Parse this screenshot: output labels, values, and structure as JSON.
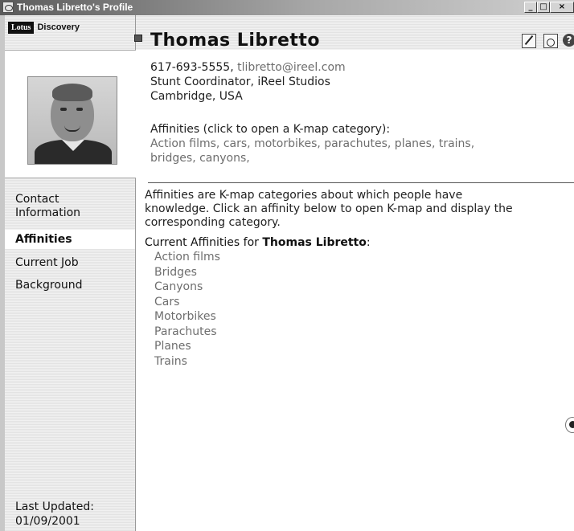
{
  "window": {
    "title": "Thomas Libretto's Profile",
    "controls": {
      "minimize": "_",
      "maximize": "□",
      "close": "×"
    }
  },
  "logo": {
    "lotus": "Lotus",
    "discovery": "Discovery"
  },
  "header": {
    "name": "Thomas Libretto",
    "help_icon": "?"
  },
  "contact": {
    "phone": "617-693-5555",
    "separator": ", ",
    "email": "tlibretto@ireel.com",
    "role": "Stunt Coordinator, iReel Studios",
    "location": "Cambridge, USA"
  },
  "affinities_summary": {
    "label": "Affinities (click to open a K-map category):",
    "line1": "Action films, cars, motorbikes, parachutes, planes, trains,",
    "line2": "bridges, canyons,"
  },
  "sidebar": {
    "items": [
      {
        "label_line1": "Contact",
        "label_line2": "Information",
        "active": false
      },
      {
        "label": "Affinities",
        "active": true
      },
      {
        "label": "Current Job",
        "active": false
      },
      {
        "label": "Background",
        "active": false
      }
    ],
    "last_updated_label": "Last Updated:",
    "last_updated_date": "01/09/2001"
  },
  "affinities_section": {
    "description_line1": "Affinities are K-map categories about which people have",
    "description_line2": "knowledge. Click an affinity below to open K-map and display the",
    "description_line3": "corresponding category.",
    "current_prefix": "Current Affinities for ",
    "current_name": "Thomas Libretto",
    "current_suffix": ":",
    "list": [
      "Action films",
      "Bridges",
      "Canyons",
      "Cars",
      "Motorbikes",
      "Parachutes",
      "Planes",
      "Trains"
    ]
  }
}
